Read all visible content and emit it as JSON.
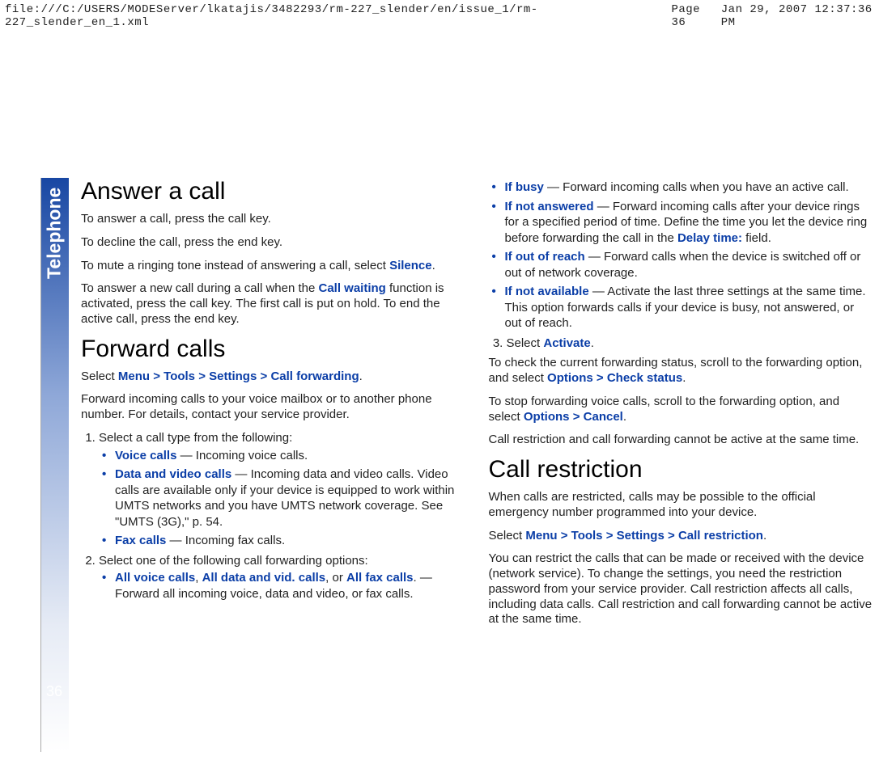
{
  "header": {
    "path": "file:///C:/USERS/MODEServer/lkatajis/3482293/rm-227_slender/en/issue_1/rm-227_slender_en_1.xml",
    "page": "Page 36",
    "date": "Jan 29, 2007 12:37:36 PM"
  },
  "section_tab": "Telephone",
  "page_number": "36",
  "left": {
    "h_answer": "Answer a call",
    "p1": "To answer a call, press the call key.",
    "p2": "To decline the call, press the end key.",
    "p3a": "To mute a ringing tone instead of answering a call, select ",
    "p3_term": "Silence",
    "p3b": ".",
    "p4a": "To answer a new call during a call when the ",
    "p4_term": "Call waiting",
    "p4b": " function is activated, press the call key. The first call is put on hold. To end the active call, press the end key.",
    "h_forward": "Forward calls",
    "fwd_sel_a": "Select ",
    "fwd_sel_menu": "Menu",
    "fwd_sel_tools": "Tools",
    "fwd_sel_settings": "Settings",
    "fwd_sel_cf": "Call forwarding",
    "fwd_sel_b": ".",
    "fwd_p1": "Forward incoming calls to your voice mailbox or to another phone number. For details, contact your service provider.",
    "step1": "Select a call type from the following:",
    "s1_li1_t": "Voice calls",
    "s1_li1_b": " — Incoming voice calls.",
    "s1_li2_t": "Data and video calls",
    "s1_li2_b": " — Incoming data and video calls. Video calls are available only if your device is equipped to work within UMTS networks and you have UMTS network coverage. See \"UMTS (3G),\" p. 54.",
    "s1_li3_t": "Fax calls",
    "s1_li3_b": " — Incoming fax calls.",
    "step2": "Select one of the following call forwarding options:",
    "s2_li1_t1": "All voice calls",
    "s2_li1_t2": "All data and vid. calls",
    "s2_li1_t3": "All fax calls",
    "s2_li1_b": ". — Forward all incoming voice, data and video, or fax calls.",
    "comma": ", ",
    "or": ", or "
  },
  "right": {
    "s2_li2_t": "If busy",
    "s2_li2_b": " — Forward incoming calls when you have an active call.",
    "s2_li3_t": "If not answered",
    "s2_li3_b": " — Forward incoming calls after your device rings for a specified period of time. Define the time you let the device ring before forwarding the call in the ",
    "s2_li3_t2": "Delay time:",
    "s2_li3_c": " field.",
    "s2_li4_t": "If out of reach",
    "s2_li4_b": " —  Forward calls when the device is switched off or out of network coverage.",
    "s2_li5_t": "If not available",
    "s2_li5_b": " — Activate the last three settings at the same time. This option forwards calls if your device is busy, not answered, or out of reach.",
    "step3_a": "Select ",
    "step3_t": "Activate",
    "step3_b": ".",
    "p_check_a": "To check the current forwarding status, scroll to the forwarding option, and select ",
    "p_check_t1": "Options",
    "p_check_t2": "Check status",
    "p_check_b": ".",
    "p_cancel_a": "To stop forwarding voice calls, scroll to the forwarding option, and select ",
    "p_cancel_t1": "Options",
    "p_cancel_t2": "Cancel",
    "p_cancel_b": ".",
    "p_note": "Call restriction and call forwarding cannot be active at the same time.",
    "h_restrict": "Call restriction",
    "r_p1": "When calls are restricted, calls may be possible to the official emergency number programmed into your device.",
    "r_sel_a": "Select ",
    "r_sel_menu": "Menu",
    "r_sel_tools": "Tools",
    "r_sel_settings": "Settings",
    "r_sel_cr": "Call restriction",
    "r_sel_b": ".",
    "r_p2": "You can restrict the calls that can be made or received with the device (network service). To change the settings, you need the restriction password from your service provider. Call restriction affects all calls, including data calls. Call restriction and call forwarding cannot be active at the same time.",
    "gt": ">"
  }
}
